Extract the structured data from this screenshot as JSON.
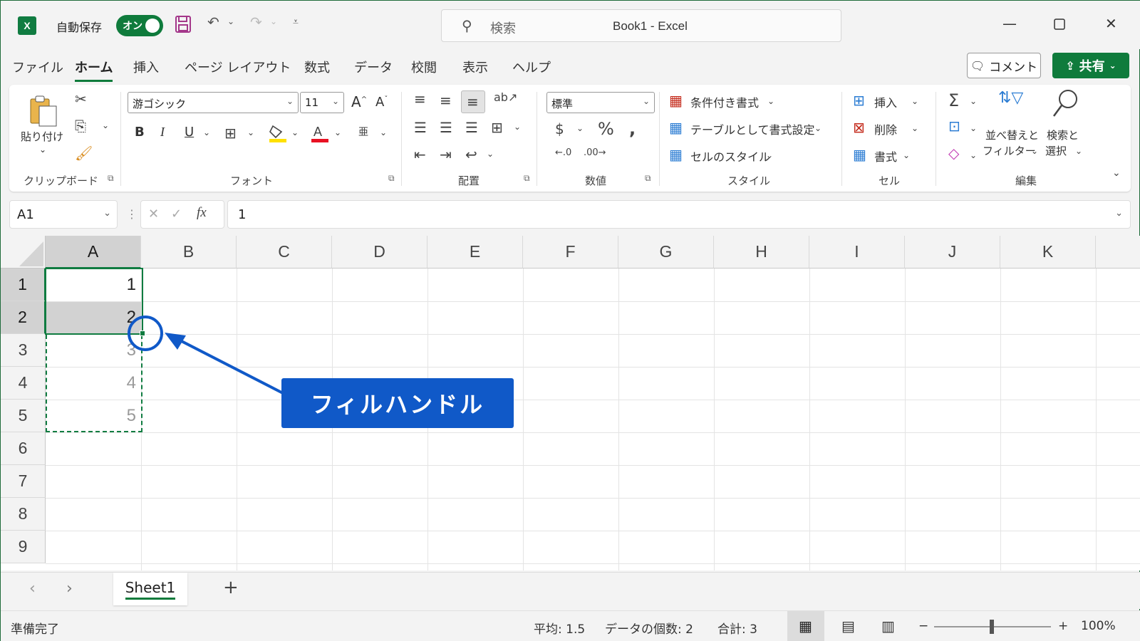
{
  "titlebar": {
    "app_icon": "excel-logo",
    "app_icon_letter": "X",
    "autosave_label": "自動保存",
    "autosave_state": "オン",
    "search_placeholder": "検索",
    "doc_title": "Book1  -  Excel",
    "icons": [
      "save-icon",
      "undo-icon",
      "redo-icon",
      "customize-qat-icon",
      "minimize-icon",
      "maximize-icon",
      "close-icon"
    ]
  },
  "menu": {
    "tabs": [
      "ファイル",
      "ホーム",
      "挿入",
      "ページ レイアウト",
      "数式",
      "データ",
      "校閲",
      "表示",
      "ヘルプ"
    ],
    "active": "ホーム",
    "comment_label": "コメント",
    "share_label": "共有"
  },
  "ribbon": {
    "clipboard": {
      "paste": "貼り付け",
      "label": "クリップボード"
    },
    "font": {
      "family": "游ゴシック",
      "size": "11",
      "bold": "B",
      "italic": "I",
      "underline": "U",
      "label": "フォント"
    },
    "alignment": {
      "label": "配置"
    },
    "number": {
      "format": "標準",
      "label": "数値"
    },
    "styles": {
      "conditional": "条件付き書式",
      "table": "テーブルとして書式設定",
      "cell_styles": "セルのスタイル",
      "label": "スタイル"
    },
    "cells": {
      "insert": "挿入",
      "delete": "削除",
      "format": "書式",
      "label": "セル"
    },
    "editing": {
      "sort_line1": "並べ替えと",
      "sort_line2": "フィルター",
      "find_line1": "検索と",
      "find_line2": "選択",
      "label": "編集"
    }
  },
  "formula": {
    "namebox": "A1",
    "fx": "fx",
    "value": "1"
  },
  "grid": {
    "columns": [
      "A",
      "B",
      "C",
      "D",
      "E",
      "F",
      "G",
      "H",
      "I",
      "J",
      "K"
    ],
    "rows": [
      "1",
      "2",
      "3",
      "4",
      "5",
      "6",
      "7",
      "8",
      "9"
    ],
    "cells": {
      "A1": "1",
      "A2": "2",
      "A3": "3",
      "A4": "4",
      "A5": "5"
    }
  },
  "sheets": {
    "tabs": [
      "Sheet1"
    ],
    "add": "+"
  },
  "status": {
    "ready": "準備完了",
    "average": "平均: 1.5",
    "count": "データの個数: 2",
    "sum": "合計: 3",
    "zoom": "100%"
  },
  "annotation": {
    "label": "フィルハンドル",
    "color": "#1059c8"
  },
  "colors": {
    "accent": "#107c41",
    "callout": "#1059c8"
  }
}
